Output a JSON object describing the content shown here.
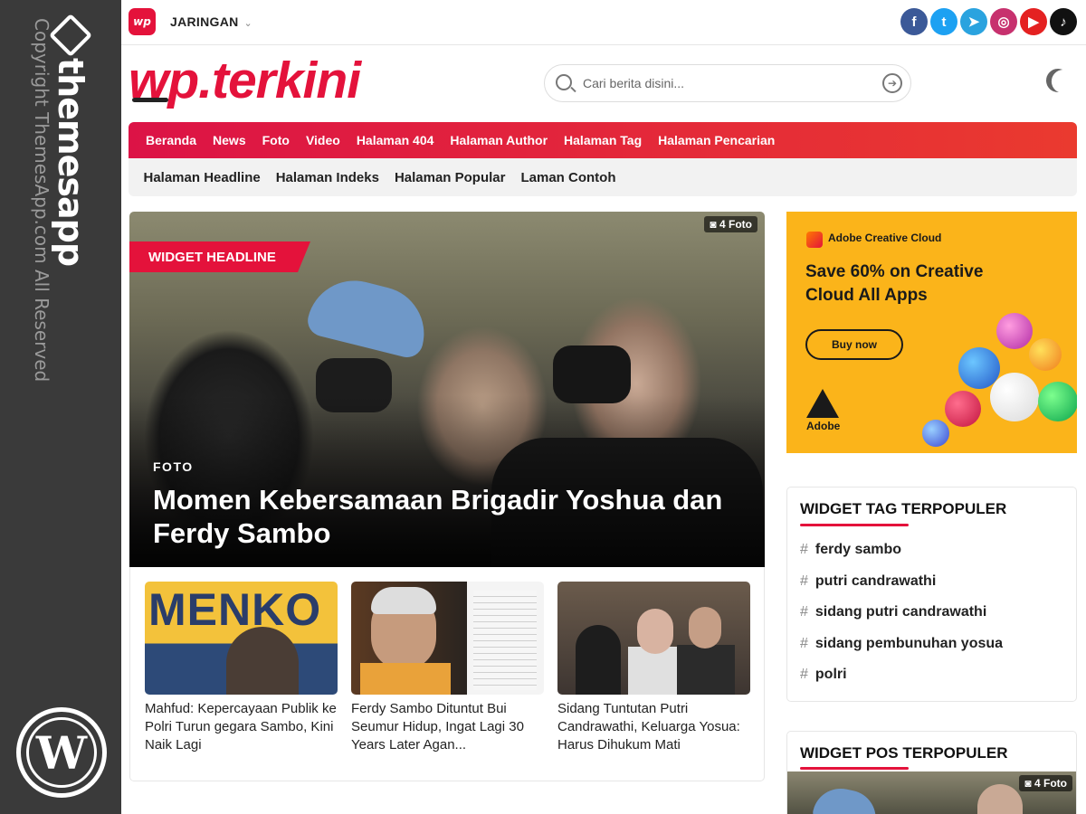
{
  "sidebar": {
    "brand": "themesapp",
    "copyright": "Copyright ThemesApp.com All Reserved",
    "wordpress_letter": "W"
  },
  "topbar": {
    "mini_logo": "wp",
    "network_label": "JARINGAN",
    "socials": [
      {
        "icon": "facebook-icon",
        "glyph": "f",
        "color": "#3b5998"
      },
      {
        "icon": "twitter-icon",
        "glyph": "t",
        "color": "#1da1f2"
      },
      {
        "icon": "telegram-icon",
        "glyph": "➤",
        "color": "#2aa3df"
      },
      {
        "icon": "instagram-icon",
        "glyph": "◎",
        "color": "#c7316e"
      },
      {
        "icon": "youtube-icon",
        "glyph": "▶",
        "color": "#e42121"
      },
      {
        "icon": "tiktok-icon",
        "glyph": "♪",
        "color": "#111111"
      }
    ]
  },
  "header": {
    "logo": "wp.terkini",
    "search_placeholder": "Cari berita disini..."
  },
  "nav": {
    "primary": [
      "Beranda",
      "News",
      "Foto",
      "Video",
      "Halaman 404",
      "Halaman Author",
      "Halaman Tag",
      "Halaman Pencarian"
    ],
    "secondary": [
      "Halaman Headline",
      "Halaman Indeks",
      "Halaman Popular",
      "Laman Contoh"
    ]
  },
  "headline": {
    "widget_label": "WIDGET HEADLINE",
    "photo_badge": "4 Foto",
    "category": "FOTO",
    "title": "Momen Kebersamaan Brigadir Yoshua dan Ferdy Sambo",
    "thumb1_word": "MENKO",
    "cards": [
      {
        "title": "Mahfud: Kepercayaan Publik ke Polri Turun gegara Sambo, Kini Naik Lagi"
      },
      {
        "title": "Ferdy Sambo Dituntut Bui Seumur Hidup, Ingat Lagi 30 Years Later Agan..."
      },
      {
        "title": "Sidang Tuntutan Putri Candrawathi, Keluarga Yosua: Harus Dihukum Mati"
      }
    ]
  },
  "ad": {
    "brand": "Adobe Creative Cloud",
    "headline": "Save 60% on Creative Cloud All Apps",
    "cta": "Buy now",
    "footer": "Adobe",
    "accent": "#fbb41a"
  },
  "widget_tag": {
    "title": "WIDGET TAG TERPOPULER",
    "tags": [
      "ferdy sambo",
      "putri candrawathi",
      "sidang putri candrawathi",
      "sidang pembunuhan yosua",
      "polri"
    ]
  },
  "widget_pos": {
    "title": "WIDGET POS TERPOPULER",
    "photo_badge": "4 Foto"
  },
  "colors": {
    "brand_red": "#e4123b",
    "sidebar_bg": "#3a3a3a"
  }
}
